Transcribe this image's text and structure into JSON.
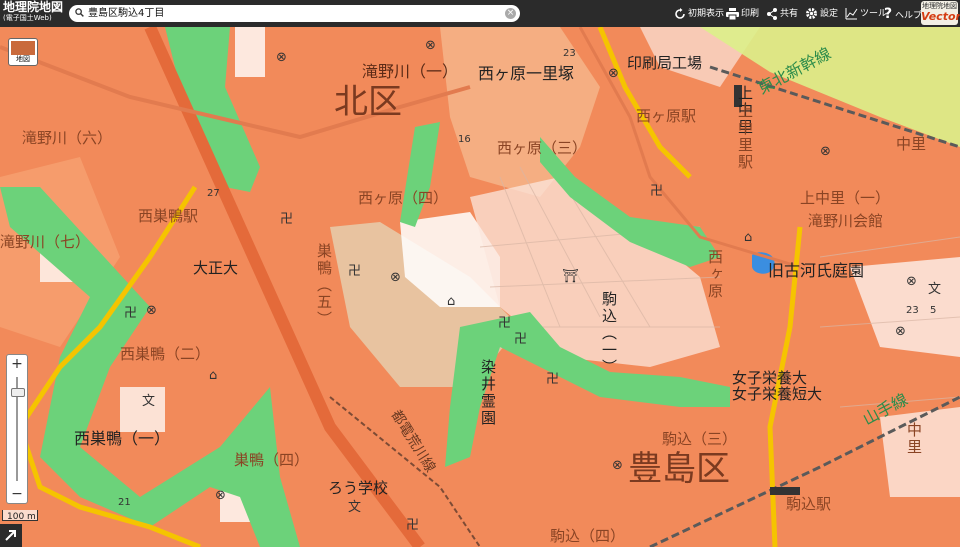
{
  "toolbar": {
    "title": "地理院地図",
    "subtitle": "(電子国土Web)",
    "search_value": "豊島区駒込4丁目",
    "buttons": [
      "初期表示",
      "印刷",
      "共有",
      "設定",
      "ツール",
      "ヘルプ"
    ],
    "vector_badge_top": "地理院地図",
    "vector_badge_bottom": "Vector"
  },
  "map": {
    "map_type_label": "地図",
    "scale_label": "100 m",
    "wards": [
      "北区",
      "豊島区"
    ],
    "areas": [
      "滝野川（一）",
      "滝野川（六）",
      "滝野川（七）",
      "西ヶ原一里塚",
      "西ヶ原（三）",
      "西ヶ原（四）",
      "上中里（一）",
      "中里",
      "西巣鴨（一）",
      "西巣鴨（二）",
      "巣鴨（四）",
      "巣鴨（五）",
      "駒込（三）",
      "駒込（四）",
      "駒込（一）",
      "西ヶ原",
      "中里",
      "上中里"
    ],
    "stations": [
      "西巣鴨駅",
      "西ヶ原駅",
      "上中里駅",
      "駒込駅"
    ],
    "facilities": [
      "印刷局工場",
      "滝野川会館",
      "旧古河氏庭園",
      "大正大",
      "女子栄養大",
      "女子栄養短大",
      "染井霊園",
      "ろう学校"
    ],
    "railways": [
      "東北新幹線",
      "山手線",
      "都電荒川線"
    ],
    "route_numbers": [
      "23",
      "27",
      "16",
      "21",
      "5",
      "23"
    ],
    "colors": {
      "hazard_orange": "#f28a5a",
      "hazard_light": "#f6b489",
      "upland_tan": "#e8c3a0",
      "green_strip": "#6cd27a",
      "water": "#3b8ee0",
      "road_yellow": "#f5c400",
      "toolbar": "#2b2b2b"
    }
  }
}
